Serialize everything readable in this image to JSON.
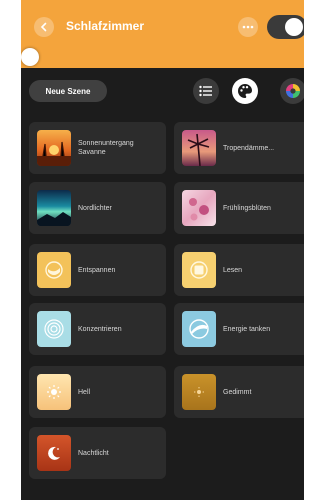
{
  "header": {
    "title": "Schlafzimmer",
    "accent_color": "#f4a43c",
    "toggle_on": true,
    "brightness_fraction": 0.0
  },
  "toolbar": {
    "new_scene_label": "Neue Szene",
    "view_icons": [
      "list-icon",
      "palette-icon",
      "color-wheel-icon"
    ]
  },
  "scenes": [
    {
      "label": "Sonnenuntergang Savanne",
      "icon": "sunset-savanna-image"
    },
    {
      "label": "Tropendämme...",
      "icon": "palm-tree-image"
    },
    {
      "label": "Nordlichter",
      "icon": "northern-lights-image"
    },
    {
      "label": "Frühlingsblüten",
      "icon": "spring-blossoms-image"
    },
    {
      "label": "Entspannen",
      "icon": "relax-icon"
    },
    {
      "label": "Lesen",
      "icon": "read-icon"
    },
    {
      "label": "Konzentrieren",
      "icon": "concentrate-icon"
    },
    {
      "label": "Energie tanken",
      "icon": "energize-icon"
    },
    {
      "label": "Hell",
      "icon": "bright-icon"
    },
    {
      "label": "Gedimmt",
      "icon": "dimmed-icon"
    },
    {
      "label": "Nachtlicht",
      "icon": "nightlight-icon"
    }
  ]
}
